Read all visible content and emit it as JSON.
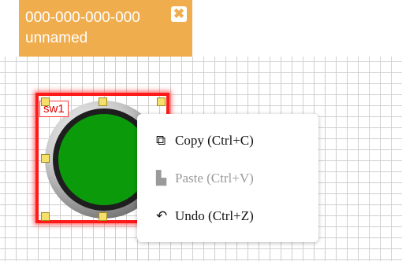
{
  "tab": {
    "id_text": "000-000-000-000",
    "name": "unnamed",
    "close_icon": "close-icon",
    "close_glyph": "✖"
  },
  "device": {
    "label": "sw1",
    "colors": {
      "selection": "#ff1a1a",
      "knob": "#0a9a0a"
    }
  },
  "context_menu": {
    "items": [
      {
        "label": "Copy (Ctrl+C)",
        "icon": "copy-icon",
        "glyph": "⧉",
        "enabled": true
      },
      {
        "label": "Paste (Ctrl+V)",
        "icon": "paste-icon",
        "glyph": "▙",
        "enabled": false
      },
      {
        "label": "Undo (Ctrl+Z)",
        "icon": "undo-icon",
        "glyph": "↶",
        "enabled": true
      }
    ]
  },
  "colors": {
    "tab_background": "#f0ad4e",
    "grid_line": "#cfcfcf"
  }
}
